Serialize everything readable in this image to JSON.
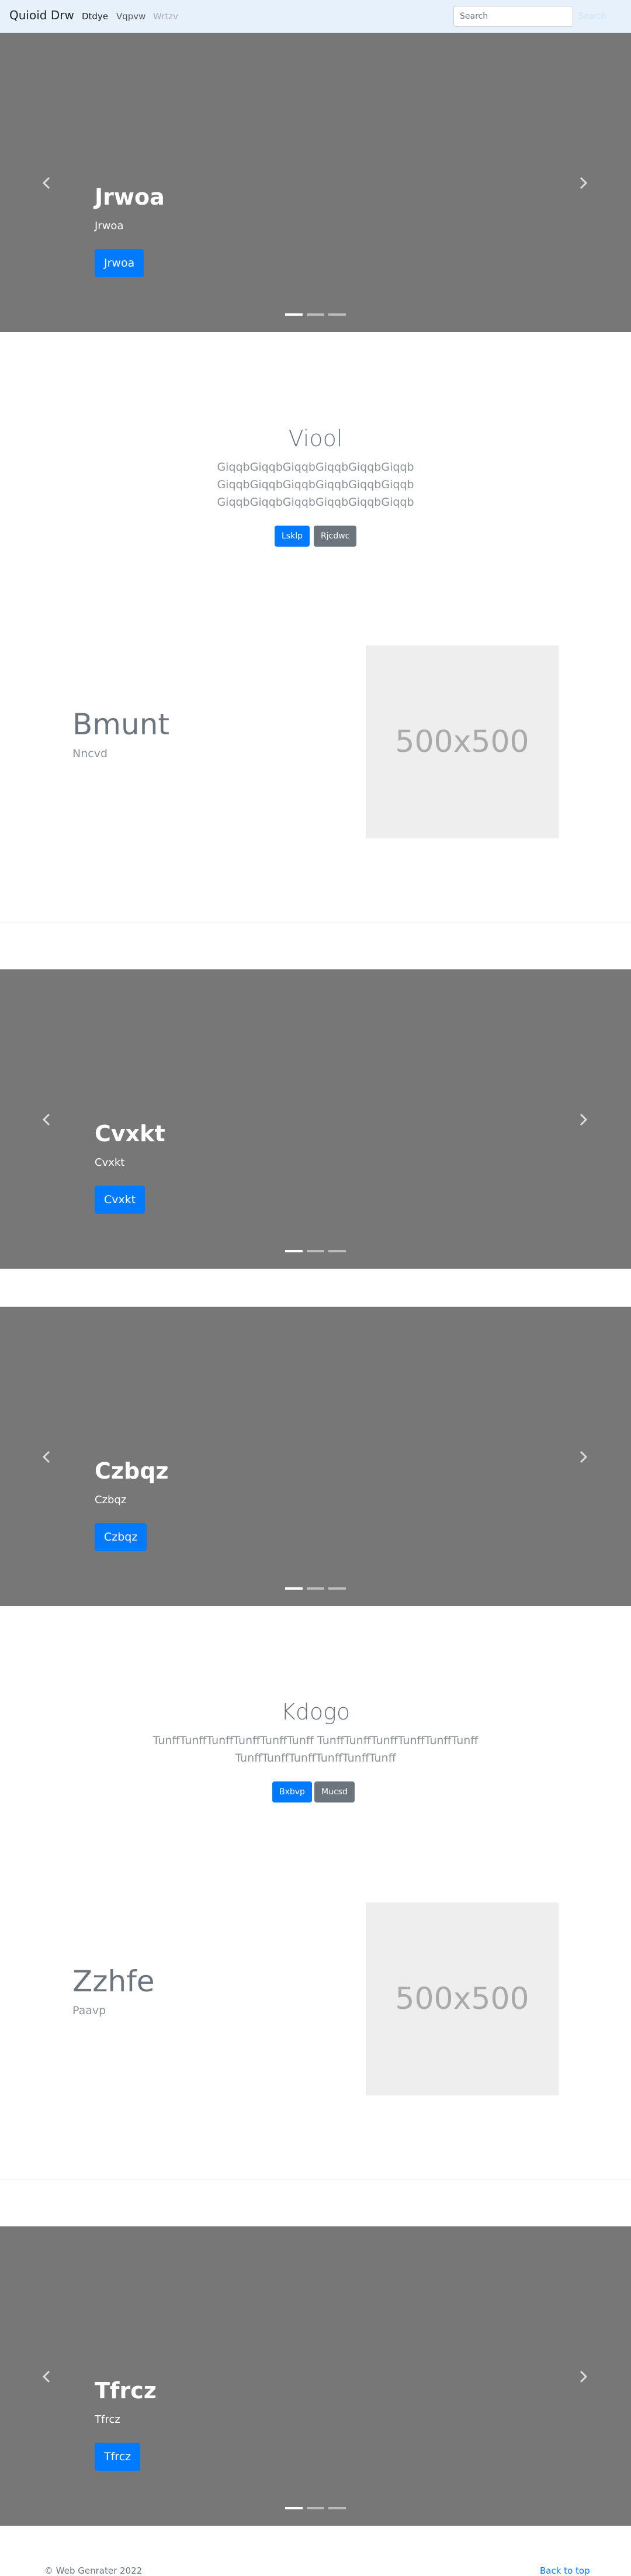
{
  "navbar": {
    "brand": "Quioid Drw",
    "links": [
      "Dtdye",
      "Vqpvw",
      "Wrtzv"
    ],
    "search_placeholder": "Search",
    "search_button": "Search"
  },
  "carousels": [
    {
      "title": "Jrwoa",
      "subtitle": "Jrwoa",
      "button": "Jrwoa"
    },
    {
      "title": "Cvxkt",
      "subtitle": "Cvxkt",
      "button": "Cvxkt"
    },
    {
      "title": "Czbqz",
      "subtitle": "Czbqz",
      "button": "Czbqz"
    },
    {
      "title": "Tfrcz",
      "subtitle": "Tfrcz",
      "button": "Tfrcz"
    }
  ],
  "sections": [
    {
      "title": "Viool",
      "lead_lines": [
        "GiqqbGiqqbGiqqbGiqqbGiqqbGiqqb",
        "GiqqbGiqqbGiqqbGiqqbGiqqbGiqqb",
        "GiqqbGiqqbGiqqbGiqqbGiqqbGiqqb"
      ],
      "primary": "Lsklp",
      "secondary": "Rjcdwc"
    },
    {
      "title": "Kdogo",
      "lead_lines": [
        "TunffTunffTunffTunffTunffTunff TunffTunffTunffTunffTunffTunff",
        "TunffTunffTunffTunffTunffTunff"
      ],
      "primary": "Bxbvp",
      "secondary": "Mucsd"
    }
  ],
  "featurettes": [
    {
      "title": "Bmunt",
      "subtitle": "Nncvd",
      "image_label": "500x500"
    },
    {
      "title": "Zzhfe",
      "subtitle": "Paavp",
      "image_label": "500x500"
    }
  ],
  "footer": {
    "copyright": "© Web Genrater 2022",
    "back_to_top": "Back to top"
  },
  "colors": {
    "navbar_bg": "#e6f1fb",
    "carousel_bg": "#777777",
    "primary": "#007bff",
    "secondary": "#6c757d"
  },
  "icons": [
    "chevron-left-icon",
    "chevron-right-icon"
  ]
}
